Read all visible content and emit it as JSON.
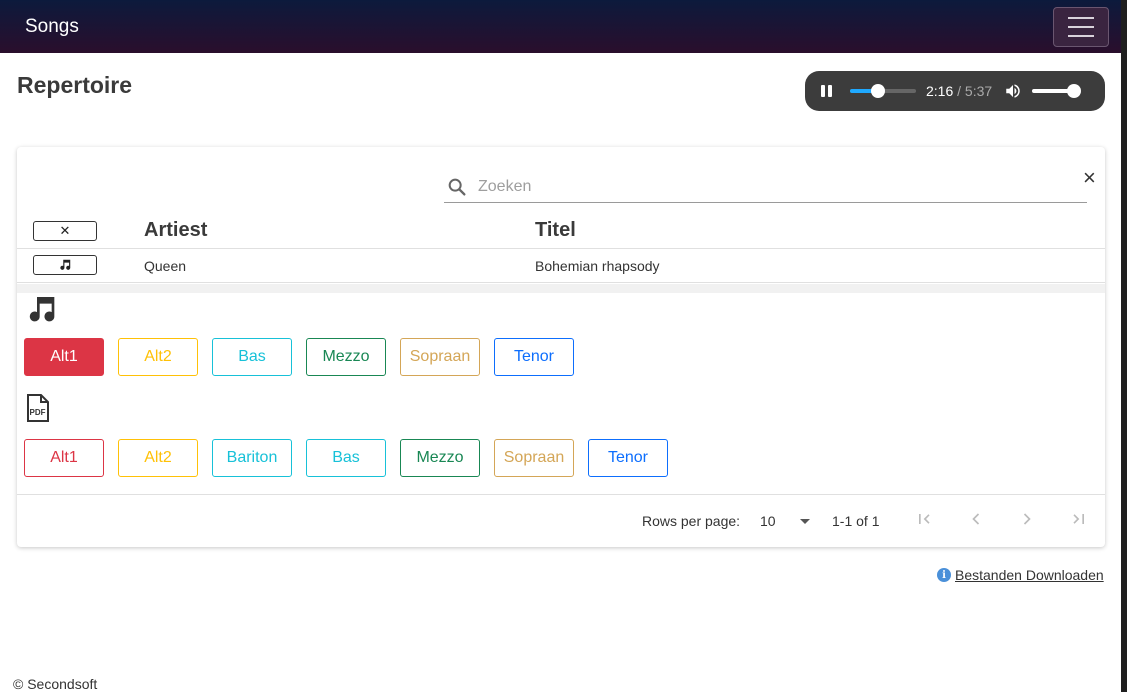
{
  "navbar": {
    "brand": "Songs"
  },
  "page": {
    "title": "Repertoire"
  },
  "player": {
    "current_time": "2:16",
    "total_time": "5:37",
    "progress": 0.42,
    "volume": 0.95,
    "accent": "#1fa9ff"
  },
  "search": {
    "placeholder": "Zoeken",
    "value": "",
    "clear_label": "×"
  },
  "table": {
    "header_toggle_label": "✕",
    "columns": [
      "Artiest",
      "Titel"
    ],
    "rows": [
      {
        "toggle_icon": "music-note-icon",
        "artist": "Queen",
        "title": "Bohemian rhapsody"
      }
    ]
  },
  "audio_parts": [
    {
      "label": "Alt1",
      "color": "#dc3545",
      "filled": true
    },
    {
      "label": "Alt2",
      "color": "#ffc107",
      "filled": false
    },
    {
      "label": "Bas",
      "color": "#17c1d8",
      "filled": false
    },
    {
      "label": "Mezzo",
      "color": "#198754",
      "filled": false
    },
    {
      "label": "Sopraan",
      "color": "#d4a657",
      "filled": false
    },
    {
      "label": "Tenor",
      "color": "#0d6efd",
      "filled": false
    }
  ],
  "pdf_parts": [
    {
      "label": "Alt1",
      "color": "#dc3545"
    },
    {
      "label": "Alt2",
      "color": "#ffc107"
    },
    {
      "label": "Bariton",
      "color": "#17c1d8"
    },
    {
      "label": "Bas",
      "color": "#17c1d8"
    },
    {
      "label": "Mezzo",
      "color": "#198754"
    },
    {
      "label": "Sopraan",
      "color": "#d4a657"
    },
    {
      "label": "Tenor",
      "color": "#0d6efd"
    }
  ],
  "pdf_icon_text": "PDF",
  "pagination": {
    "rows_per_page_label": "Rows per page:",
    "rows_per_page": "10",
    "range": "1-1 of 1"
  },
  "download": {
    "info_glyph": "i",
    "label": " Bestanden Downloaden"
  },
  "footer": {
    "text": "© Secondsoft"
  }
}
